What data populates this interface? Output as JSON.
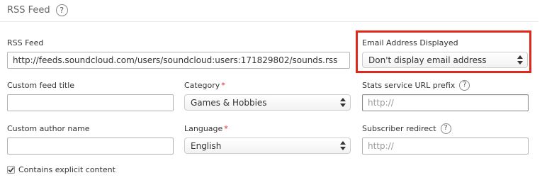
{
  "section": {
    "title": "RSS Feed",
    "help_glyph": "?"
  },
  "rss_feed": {
    "label": "RSS Feed",
    "value": "http://feeds.soundcloud.com/users/soundcloud:users:171829802/sounds.rss"
  },
  "email_display": {
    "label": "Email Address Displayed",
    "selected": "Don't display email address"
  },
  "custom_feed_title": {
    "label": "Custom feed title",
    "value": ""
  },
  "category": {
    "label": "Category",
    "required_mark": "*",
    "selected": "Games & Hobbies"
  },
  "stats_prefix": {
    "label": "Stats service URL prefix",
    "help_glyph": "?",
    "placeholder": "http://"
  },
  "custom_author": {
    "label": "Custom author name",
    "value": ""
  },
  "language": {
    "label": "Language",
    "required_mark": "*",
    "selected": "English"
  },
  "subscriber_redirect": {
    "label": "Subscriber redirect",
    "help_glyph": "?",
    "placeholder": "http://"
  },
  "explicit": {
    "label": "Contains explicit content",
    "checked": true
  },
  "colors": {
    "highlight": "#e1261c",
    "required": "#e0262b"
  }
}
